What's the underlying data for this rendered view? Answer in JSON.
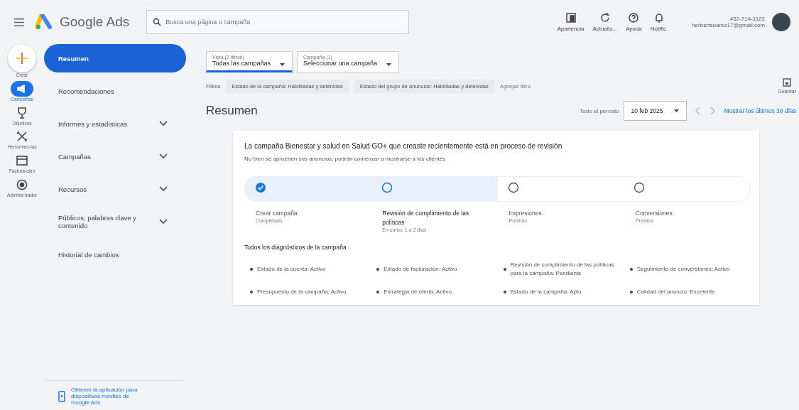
{
  "header": {
    "product": "Google Ads",
    "search_placeholder": "Busca una página o campaña",
    "tools": [
      {
        "kind": "appearance",
        "label": "Apariencia"
      },
      {
        "kind": "refresh",
        "label": "Actualiz..."
      },
      {
        "kind": "help",
        "label": "Ayuda"
      },
      {
        "kind": "bell",
        "label": "Notific."
      }
    ],
    "account": {
      "id": "452-714-1122",
      "email": "herbertsuarez17@gmail.com"
    }
  },
  "rail": [
    {
      "kind": "create",
      "label": "Crear",
      "selected": false
    },
    {
      "kind": "campaigns",
      "label": "Campañas",
      "selected": true
    },
    {
      "kind": "goals",
      "label": "Objetivos",
      "selected": false
    },
    {
      "kind": "tools",
      "label": "Herramien-tas",
      "selected": false
    },
    {
      "kind": "billing",
      "label": "Factura-ción",
      "selected": false
    },
    {
      "kind": "admin",
      "label": "Adminis-trador",
      "selected": false
    }
  ],
  "nav": [
    {
      "label": "Resumen",
      "selected": true,
      "expandable": false
    },
    {
      "label": "Recomendaciones",
      "selected": false,
      "expandable": false
    },
    {
      "label": "Informes y estadísticas",
      "selected": false,
      "expandable": true
    },
    {
      "label": "Campañas",
      "selected": false,
      "expandable": true
    },
    {
      "label": "Recursos",
      "selected": false,
      "expandable": true
    },
    {
      "label": "Públicos, palabras clave y contenido",
      "selected": false,
      "expandable": true
    },
    {
      "label": "Historial de cambios",
      "selected": false,
      "expandable": false
    }
  ],
  "nav_footer": "Obtener la aplicación para dispositivos móviles de Google Ads",
  "selectors": [
    {
      "caption": "Vista (2 filtros)",
      "value": "Todas las campañas",
      "selected": true
    },
    {
      "caption": "Campaña (1)",
      "value": "Seleccionar una campaña",
      "selected": false
    }
  ],
  "filters": {
    "label": "Filtros",
    "chips": [
      "Estado de la campaña: Habilitadas y detenidas",
      "Estado del grupo de anuncios: Habilitadas y detenidas"
    ],
    "add": "Agregar filtro",
    "save": "Guardar"
  },
  "page_title": "Resumen",
  "date": {
    "label": "Todo el período",
    "value": "10 feb 2025",
    "link": "Mostrar los últimos 30 días"
  },
  "card": {
    "title": "La campaña Bienestar y salud en Salud GO+ que creaste recientemente está en proceso de revisión",
    "subtitle": "No bien se aprueben sus anuncios, podrán comenzar a mostrarse a los clientes",
    "steps": [
      {
        "kind": "done",
        "title": "Crear campaña",
        "status": "Completado"
      },
      {
        "kind": "current",
        "title": "Revisión de cumplimiento de las políticas",
        "status": "En curso: 1 a 2 días"
      },
      {
        "kind": "pending",
        "title": "Impresiones",
        "status": "Próximo"
      },
      {
        "kind": "pending",
        "title": "Conversiones",
        "status": "Próximo"
      }
    ],
    "diagnostics_title": "Todos los diagnósticos de la campaña",
    "diagnostics": [
      "Estado de la cuenta: Activo",
      "Estado de facturación: Activo",
      "Revisión de cumplimiento de las políticas para la campaña: Pendiente",
      "Seguimiento de conversiones: Activo",
      "Presupuesto de la campaña: Activo",
      "Estrategia de oferta: Activo",
      "Estado de la campaña: Apto",
      "Calidad del anuncio: Excelente"
    ]
  }
}
